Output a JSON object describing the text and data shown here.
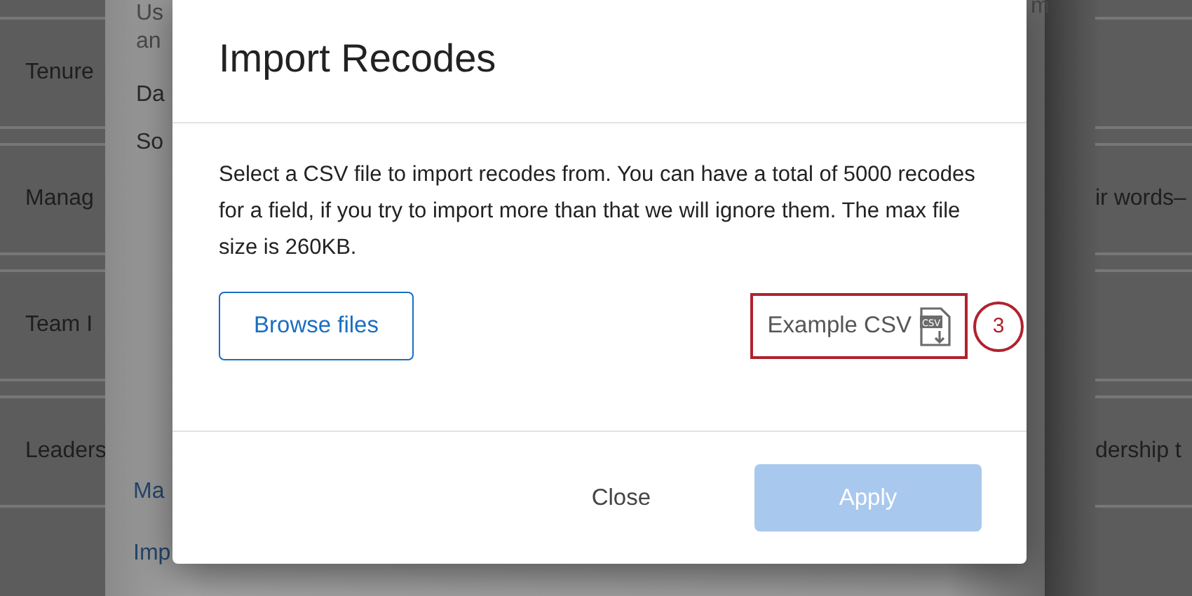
{
  "table_rows": [
    {
      "label": "Tenure"
    },
    {
      "label": "Manag",
      "extra": "ir words–"
    },
    {
      "label": "Team I"
    },
    {
      "label": "Leaders",
      "extra": "dership t"
    }
  ],
  "panel": {
    "top_lines": [
      "Us",
      "an",
      "Da",
      "So"
    ],
    "corner_text": "m",
    "links": [
      "Ma",
      "Imp"
    ]
  },
  "modal": {
    "title": "Import Recodes",
    "description": "Select a CSV file to import recodes from. You can have a total of 5000 recodes for a field, if you try to import more than that we will ignore them. The max file size is 260KB.",
    "browse_button": "Browse files",
    "example_link": {
      "label": "Example CSV",
      "icon_label": "CSV",
      "highlighted": true,
      "callout": "3"
    },
    "close_button": "Close",
    "apply_button": {
      "label": "Apply",
      "disabled": true
    }
  }
}
